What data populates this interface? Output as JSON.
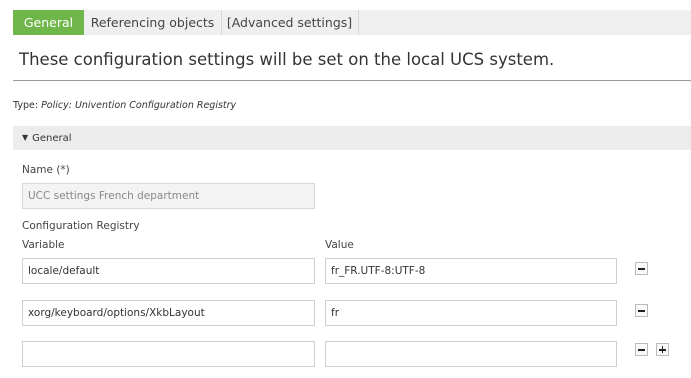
{
  "tabs": [
    {
      "label": "General",
      "active": true
    },
    {
      "label": "Referencing objects",
      "active": false
    },
    {
      "label": "[Advanced settings]",
      "active": false
    }
  ],
  "header": {
    "title": "These configuration settings will be set on the local UCS system."
  },
  "type_info": {
    "prefix": "Type:",
    "value": "Policy: Univention Configuration Registry"
  },
  "section": {
    "title": "General",
    "expanded": true
  },
  "name_field": {
    "label": "Name (*)",
    "value": "UCC settings French department",
    "disabled": true
  },
  "registry": {
    "label": "Configuration Registry",
    "variable_header": "Variable",
    "value_header": "Value",
    "rows": [
      {
        "variable": "locale/default",
        "value": "fr_FR.UTF-8:UTF-8"
      },
      {
        "variable": "xorg/keyboard/options/XkbLayout",
        "value": "fr"
      },
      {
        "variable": "",
        "value": ""
      }
    ]
  },
  "colors": {
    "active_tab": "#6fb74a",
    "tab_bar": "#efefef",
    "section_header": "#ececec"
  }
}
